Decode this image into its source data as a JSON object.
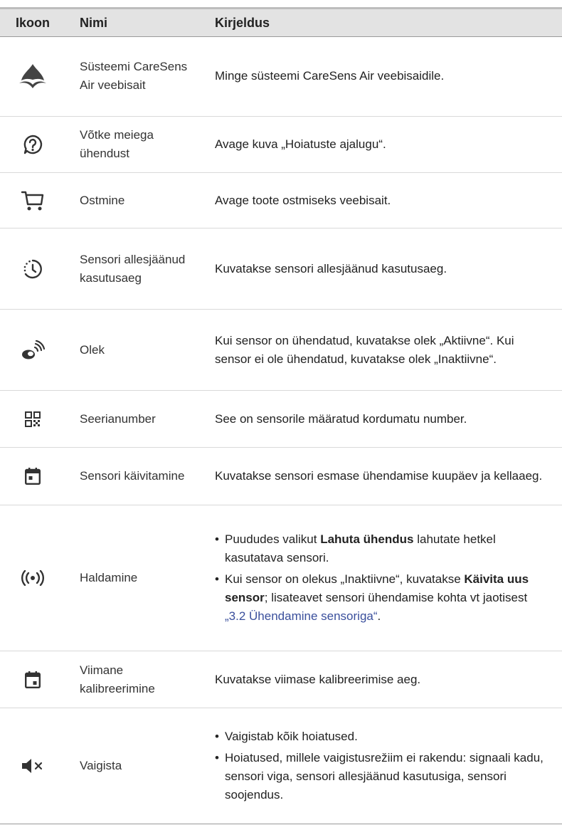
{
  "header": {
    "icon": "Ikoon",
    "name": "Nimi",
    "desc": "Kirjeldus"
  },
  "rows": [
    {
      "icon": "water-drop-icon",
      "name": "Süsteemi CareSens Air veebisait",
      "desc": "Minge süsteemi CareSens Air veebisaidile."
    },
    {
      "icon": "question-chat-icon",
      "name": "Võtke meiega ühendust",
      "desc": "Avage kuva „Hoiatuste ajalugu“."
    },
    {
      "icon": "cart-icon",
      "name": "Ostmine",
      "desc": "Avage toote ostmiseks veebisait."
    },
    {
      "icon": "timer-icon",
      "name": "Sensori allesjäänud kasutusaeg",
      "desc": "Kuvatakse sensori allesjäänud kasutusaeg."
    },
    {
      "icon": "sensor-signal-icon",
      "name": "Olek",
      "desc": "Kui sensor on ühendatud, kuvatakse olek „Aktiivne“. Kui sensor ei ole ühendatud, kuvatakse olek „Inaktiivne“."
    },
    {
      "icon": "qr-code-icon",
      "name": "Seerianumber",
      "desc": "See on sensorile määratud kordumatu number."
    },
    {
      "icon": "calendar-icon",
      "name": "Sensori käivitamine",
      "desc": "Kuvatakse sensori esmase ühendamise kuupäev ja kellaaeg."
    },
    {
      "icon": "broadcast-icon",
      "name": "Haldamine",
      "b1_pre": "Puududes valikut ",
      "b1_bold": "Lahuta ühendus",
      "b1_post": " lahutate hetkel kasutatava sensori.",
      "b2_pre": "Kui sensor on olekus „Inaktiivne“, kuvatakse ",
      "b2_bold": "Käivita uus sensor",
      "b2_mid": "; lisateavet sensori ühendamise kohta vt jaotisest ",
      "b2_link": "„3.2 Ühendamine sensoriga“",
      "b2_post": "."
    },
    {
      "icon": "calendar-bottom-icon",
      "name": "Viimane kalibreerimine",
      "desc": "Kuvatakse viimase kalibreerimise aeg."
    },
    {
      "icon": "mute-icon",
      "name": "Vaigista",
      "b1": "Vaigistab kõik hoiatused.",
      "b2": "Hoiatused, millele vaigistusrežiim ei rakendu: signaali kadu, sensori viga, sensori allesjäänud kasutusiga, sensori soojendus."
    }
  ]
}
